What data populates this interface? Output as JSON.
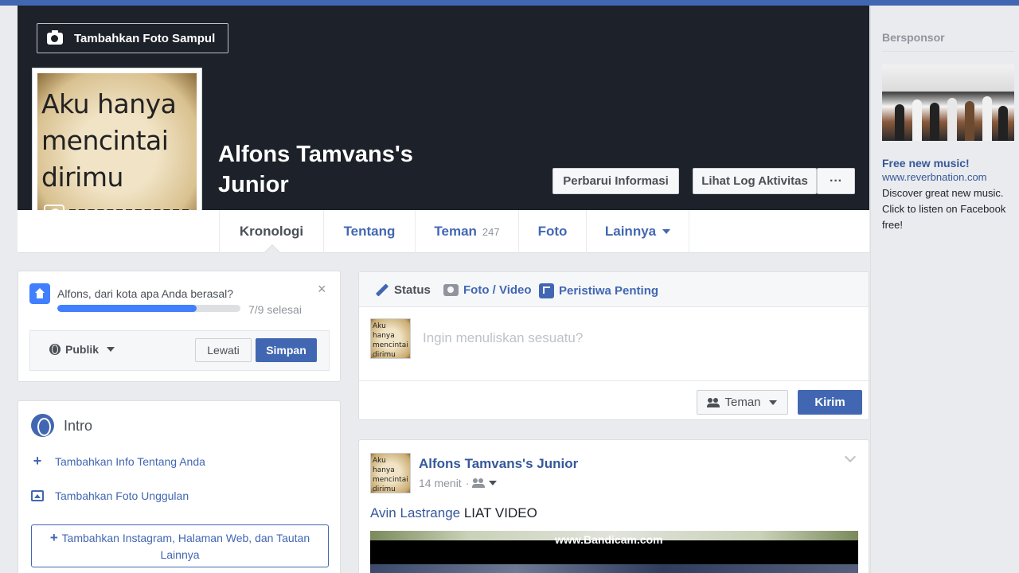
{
  "cover": {
    "add_cover_label": "Tambahkan Foto Sampul",
    "profile_name": "Alfons Tamvans's Junior",
    "profile_pic_text": [
      "Aku hanya",
      "mencintai",
      "dirimu"
    ],
    "update_info_label": "Perbarui Informasi",
    "activity_log_label": "Lihat Log Aktivitas",
    "more_label": "···"
  },
  "tabs": [
    {
      "label": "Kronologi",
      "active": true
    },
    {
      "label": "Tentang"
    },
    {
      "label": "Teman",
      "count": "247"
    },
    {
      "label": "Foto"
    },
    {
      "label": "Lainnya"
    }
  ],
  "question": {
    "text": "Alfons, dari kota apa Anda berasal?",
    "progress_text": "7/9 selesai",
    "progress_fraction": 0.76,
    "close": "×",
    "privacy_label": "Publik",
    "skip_label": "Lewati",
    "save_label": "Simpan"
  },
  "intro": {
    "title": "Intro",
    "add_info": "Tambahkan Info Tentang Anda",
    "add_photos": "Tambahkan Foto Unggulan",
    "add_links": "Tambahkan Instagram, Halaman Web, dan Tautan Lainnya"
  },
  "composer": {
    "tab_status": "Status",
    "tab_photo": "Foto / Video",
    "tab_event": "Peristiwa Penting",
    "placeholder": "Ingin menuliskan sesuatu?",
    "audience_label": "Teman",
    "send_label": "Kirim"
  },
  "post": {
    "author": "Alfons Tamvans's Junior",
    "time": "14 menit",
    "mention": "Avin Lastrange",
    "text": " LIAT VIDEO",
    "video_watermark": "www.Bandicam.com"
  },
  "sidebar": {
    "title": "Bersponsor",
    "ad_title": "Free new music!",
    "ad_url": "www.reverbnation.com",
    "ad_desc": "Discover great new music. Click to listen on Facebook free!"
  },
  "colors": {
    "brand": "#4267b2",
    "cover_bg": "#1d2129",
    "page_bg": "#e9ebee"
  }
}
